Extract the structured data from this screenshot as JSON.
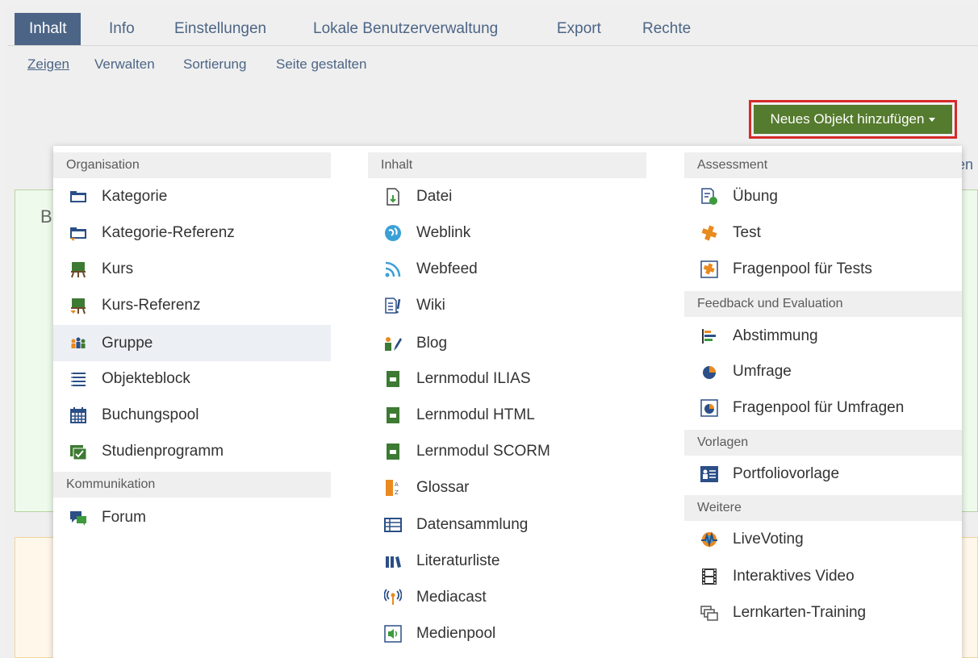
{
  "tabs": [
    "Inhalt",
    "Info",
    "Einstellungen",
    "Lokale Benutzerverwaltung",
    "Export",
    "Rechte"
  ],
  "subtabs": [
    "Zeigen",
    "Verwalten",
    "Sortierung",
    "Seite gestalten"
  ],
  "new_object_button": "Neues Objekt hinzufügen",
  "background": {
    "heading_fragment": "B",
    "right_fragment": "en"
  },
  "menu": {
    "col1": {
      "sections": [
        {
          "header": "Organisation",
          "items": [
            "Kategorie",
            "Kategorie-Referenz",
            "Kurs",
            "Kurs-Referenz",
            "Gruppe",
            "Objekteblock",
            "Buchungspool",
            "Studienprogramm"
          ]
        },
        {
          "header": "Kommunikation",
          "items": [
            "Forum"
          ]
        }
      ],
      "icons": [
        "category-icon",
        "category-reference-icon",
        "course-icon",
        "course-reference-icon",
        "group-icon",
        "object-block-icon",
        "booking-pool-icon",
        "study-program-icon",
        "forum-icon"
      ]
    },
    "col2": {
      "sections": [
        {
          "header": "Inhalt",
          "items": [
            "Datei",
            "Weblink",
            "Webfeed",
            "Wiki",
            "Blog",
            "Lernmodul ILIAS",
            "Lernmodul HTML",
            "Lernmodul SCORM",
            "Glossar",
            "Datensammlung",
            "Literaturliste",
            "Mediacast",
            "Medienpool"
          ]
        }
      ],
      "icons": [
        "file-icon",
        "weblink-icon",
        "webfeed-icon",
        "wiki-icon",
        "blog-icon",
        "learning-module-ilias-icon",
        "learning-module-html-icon",
        "learning-module-scorm-icon",
        "glossary-icon",
        "data-collection-icon",
        "bibliography-icon",
        "mediacast-icon",
        "media-pool-icon"
      ]
    },
    "col3": {
      "sections": [
        {
          "header": "Assessment",
          "items": [
            "Übung",
            "Test",
            "Fragenpool für Tests"
          ]
        },
        {
          "header": "Feedback und Evaluation",
          "items": [
            "Abstimmung",
            "Umfrage",
            "Fragenpool für Umfragen"
          ]
        },
        {
          "header": "Vorlagen",
          "items": [
            "Portfoliovorlage"
          ]
        },
        {
          "header": "Weitere",
          "items": [
            "LiveVoting",
            "Interaktives Video",
            "Lernkarten-Training"
          ]
        }
      ],
      "icons": [
        "exercise-icon",
        "test-icon",
        "test-question-pool-icon",
        "poll-icon",
        "survey-icon",
        "survey-question-pool-icon",
        "portfolio-template-icon",
        "livevoting-icon",
        "interactive-video-icon",
        "flashcard-training-icon"
      ]
    }
  },
  "highlighted_item": "Gruppe"
}
